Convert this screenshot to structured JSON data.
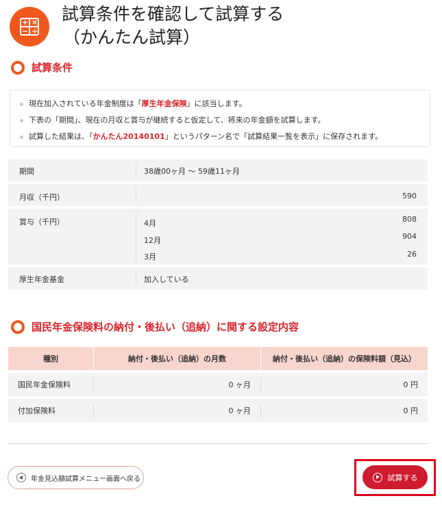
{
  "header": {
    "title_line1": "試算条件を確認して試算する",
    "title_line2": "（かんたん試算）",
    "icon": "calculator-icon",
    "accent_color": "#f0581e"
  },
  "section1": {
    "title": "試算条件",
    "notes": [
      {
        "pre": "現在加入されている年金制度は「",
        "em": "厚生年金保険",
        "post": "」に該当します。"
      },
      {
        "pre": "下表の「期間」、現在の月収と賞与が継続すると仮定して、将来の年金額を試算します。",
        "em": "",
        "post": ""
      },
      {
        "pre": "試算した結果は、「",
        "em": "かんたん20140101",
        "post": "」というパターン名で「試算結果一覧を表示」に保存されます。"
      }
    ]
  },
  "conditions": {
    "period_label": "期間",
    "period_value": "38歳00ヶ月 ～ 59歳11ヶ月",
    "monthly_label": "月収（千円）",
    "monthly_value": "590",
    "bonus_label": "賞与（千円）",
    "bonus": [
      {
        "month": "4月",
        "amount": "808"
      },
      {
        "month": "12月",
        "amount": "904"
      },
      {
        "month": "3月",
        "amount": "26"
      }
    ],
    "fund_label": "厚生年金基金",
    "fund_value": "加入している"
  },
  "section2": {
    "title": "国民年金保険料の納付・後払い（追納）に関する設定内容",
    "headers": [
      "種別",
      "納付・後払い（追納）の月数",
      "納付・後払い（追納）の保険料額（見込）"
    ],
    "rows": [
      {
        "type": "国民年金保険料",
        "months": "0 ヶ月",
        "amount": "0 円"
      },
      {
        "type": "付加保険料",
        "months": "0 ヶ月",
        "amount": "0 円"
      }
    ]
  },
  "buttons": {
    "back_label": "年金見込額試算メニュー画面へ戻る",
    "calc_label": "試算する"
  }
}
